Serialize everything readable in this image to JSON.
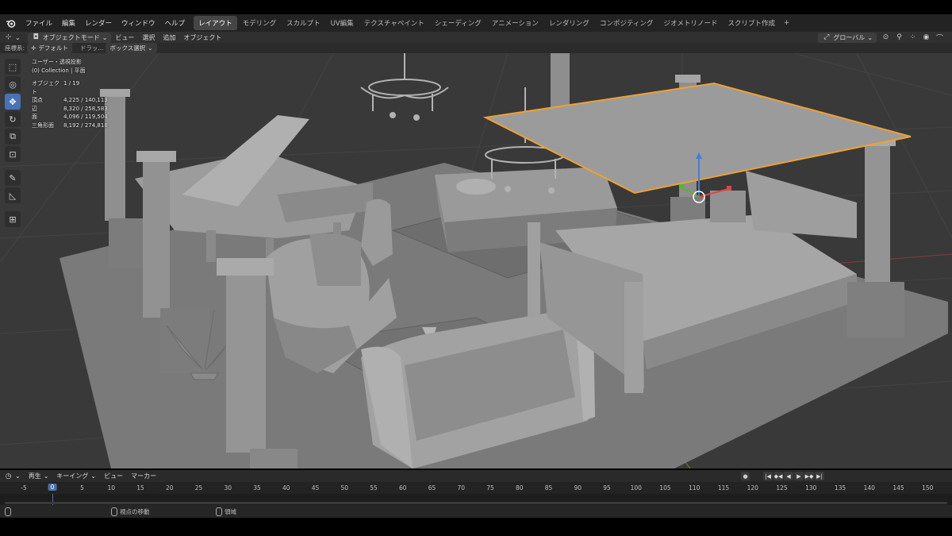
{
  "menu": {
    "items": [
      "ファイル",
      "編集",
      "レンダー",
      "ウィンドウ",
      "ヘルプ"
    ],
    "workspaces": [
      "レイアウト",
      "モデリング",
      "スカルプト",
      "UV編集",
      "テクスチャペイント",
      "シェーディング",
      "アニメーション",
      "レンダリング",
      "コンポジティング",
      "ジオメトリノード",
      "スクリプト作成"
    ],
    "active_workspace": "レイアウト",
    "add_tab": "+"
  },
  "header": {
    "mode": "オブジェクトモード",
    "view": "ビュー",
    "select": "選択",
    "add": "追加",
    "object": "オブジェクト",
    "transform_orientation": "グローバル"
  },
  "tool_settings": {
    "orientation_label": "座標系:",
    "orientation_value": "デフォルト",
    "drag_label": "ドラッ...",
    "select_mode": "ボックス選択"
  },
  "viewport_overlay": {
    "view_name": "ユーザー・透視投影",
    "collection": "(0) Collection | 平面",
    "stats": [
      {
        "label": "オブジェクト",
        "value": "1 / 19"
      },
      {
        "label": "頂点",
        "value": "4,225 / 140,113"
      },
      {
        "label": "辺",
        "value": "8,320 / 258,583"
      },
      {
        "label": "面",
        "value": "4,096 / 119,504"
      },
      {
        "label": "三角形面",
        "value": "8,192 / 274,818"
      }
    ]
  },
  "tools": [
    {
      "name": "select-box-icon",
      "glyph": "⬚"
    },
    {
      "name": "cursor-icon",
      "glyph": "◎"
    },
    {
      "name": "move-icon",
      "glyph": "✥"
    },
    {
      "name": "rotate-icon",
      "glyph": "↻"
    },
    {
      "name": "scale-icon",
      "glyph": "⧉"
    },
    {
      "name": "transform-icon",
      "glyph": "⊡"
    },
    {
      "name": "annotate-icon",
      "glyph": "✎"
    },
    {
      "name": "measure-icon",
      "glyph": "◺"
    },
    {
      "name": "add-cube-icon",
      "glyph": "⊞"
    }
  ],
  "active_tool": "move-icon",
  "timeline": {
    "playback": "再生",
    "keying": "キーイング",
    "view": "ビュー",
    "marker": "マーカー",
    "current_frame": "0",
    "ticks": [
      "-5",
      "5",
      "10",
      "15",
      "20",
      "25",
      "30",
      "35",
      "40",
      "45",
      "50",
      "55",
      "60",
      "65",
      "70",
      "75",
      "80",
      "85",
      "90",
      "95",
      "100",
      "105",
      "110",
      "115",
      "120",
      "125",
      "130",
      "135",
      "140",
      "145",
      "150"
    ],
    "transport": [
      "|◀",
      "◆◀",
      "◀",
      "▶",
      "▶◆",
      "▶|"
    ]
  },
  "status_bar": {
    "view_move": "視点の移動",
    "region": "領域"
  },
  "colors": {
    "accent": "#4772b3",
    "selection_outline": "#f0a030",
    "viewport_bg": "#393939"
  }
}
